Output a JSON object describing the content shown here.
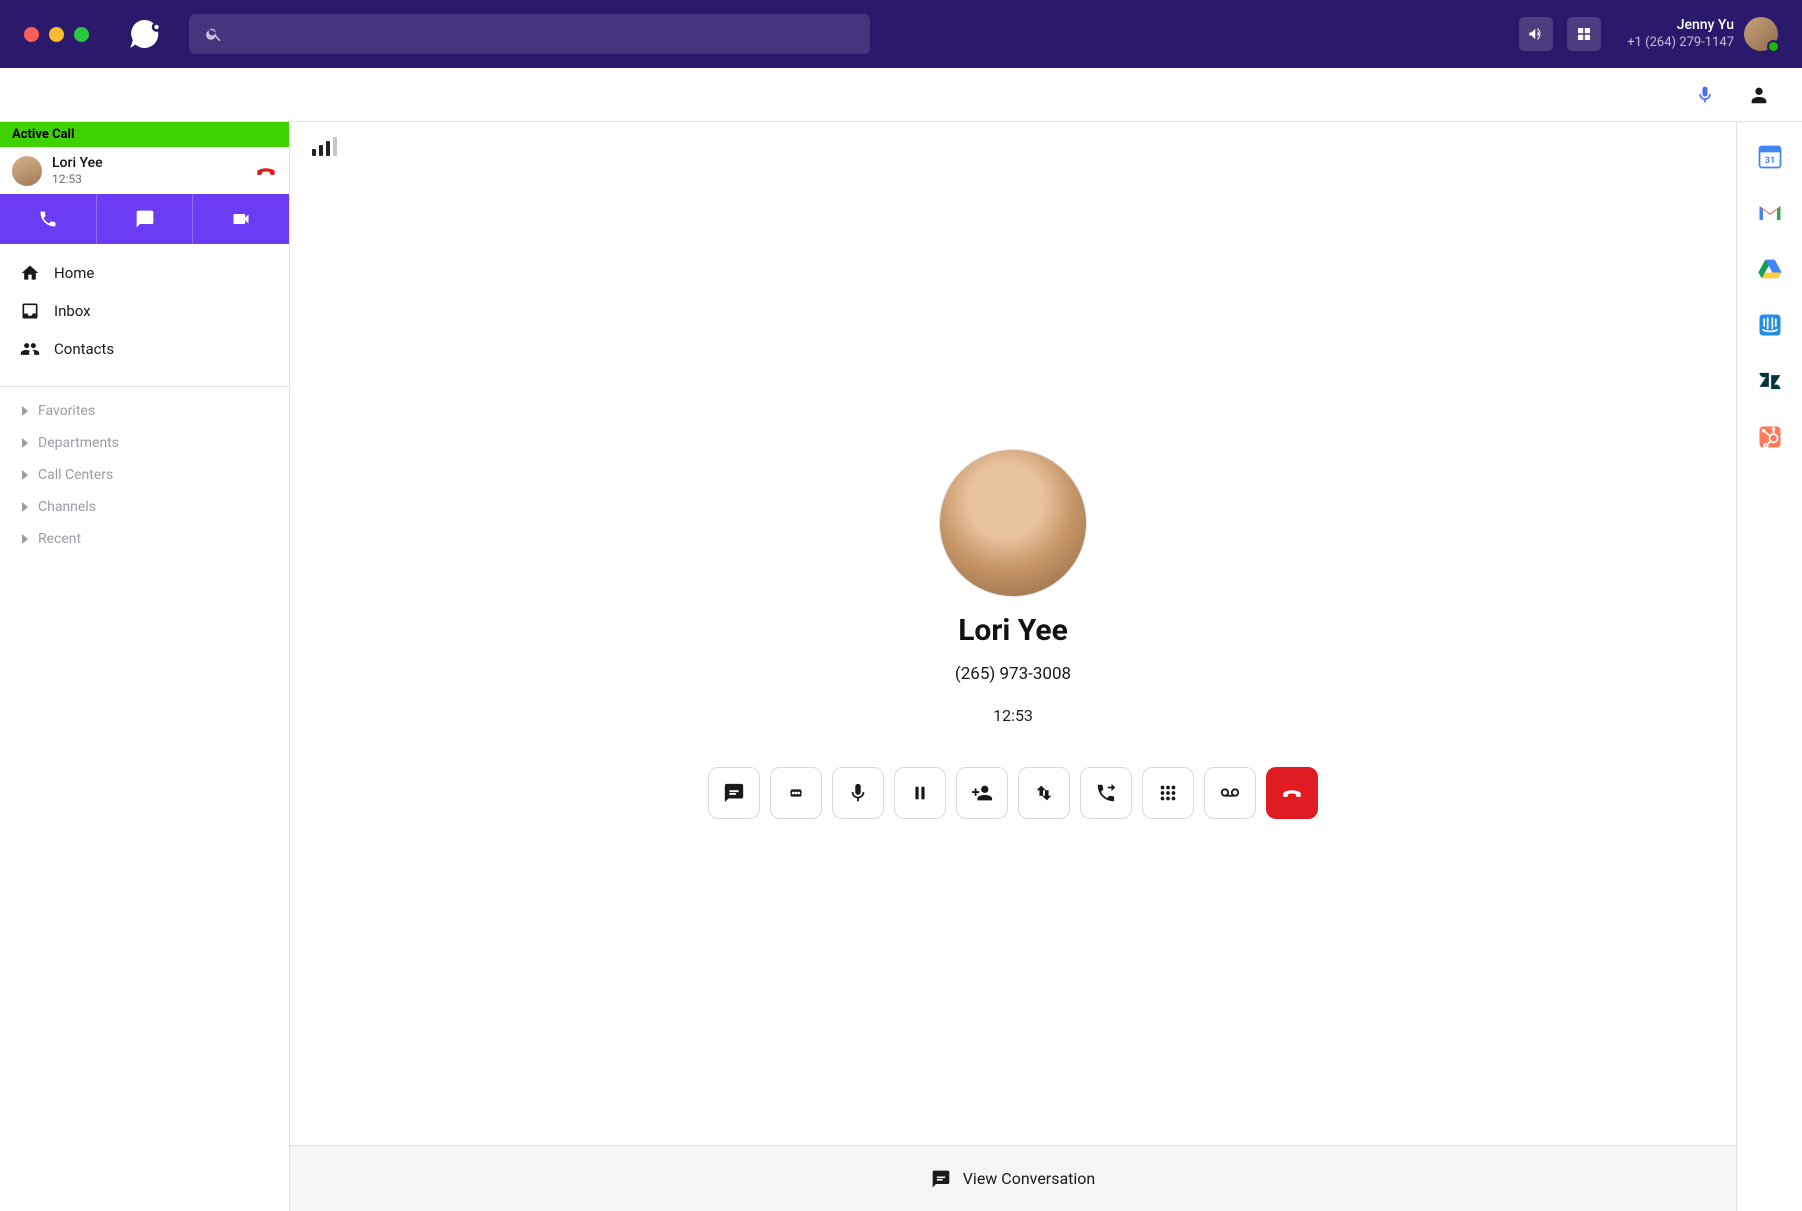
{
  "header": {
    "user_name": "Jenny Yu",
    "user_phone": "+1 (264) 279-1147"
  },
  "sidebar": {
    "active_banner": "Active Call",
    "active_call_name": "Lori Yee",
    "active_call_timer": "12:53",
    "nav": {
      "home": "Home",
      "inbox": "Inbox",
      "contacts": "Contacts"
    },
    "sections": {
      "favorites": "Favorites",
      "departments": "Departments",
      "callcenters": "Call Centers",
      "channels": "Channels",
      "recent": "Recent"
    }
  },
  "call": {
    "name": "Lori Yee",
    "phone": "(265) 973-3008",
    "timer": "12:53"
  },
  "bottom": {
    "view_conversation": "View Conversation"
  }
}
